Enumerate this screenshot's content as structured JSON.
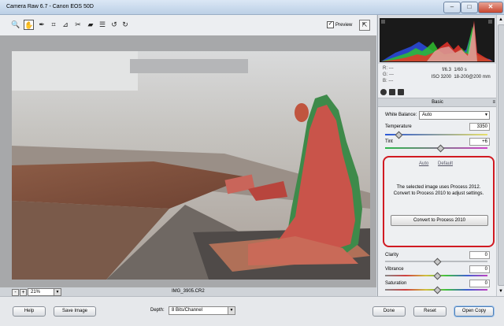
{
  "window": {
    "title": "Camera Raw 6.7  -  Canon EOS 50D",
    "minimize": "–",
    "maximize": "□",
    "close": "✕"
  },
  "toolbar": {
    "tools": [
      "🔍",
      "✋",
      "✒",
      "⌗",
      "⊿",
      "✂",
      "▰",
      "☰",
      "↺",
      "↻"
    ],
    "preview_label": "Preview",
    "preview_checked": "✓",
    "fullscreen": "⇱"
  },
  "image": {
    "filename": "IMG_3905.CR2",
    "zoom": "21%",
    "zoom_minus": "-",
    "zoom_plus": "+",
    "warning": "!"
  },
  "info": {
    "r_label": "R:",
    "r_value": "---",
    "g_label": "G:",
    "g_value": "---",
    "b_label": "B:",
    "b_value": "---",
    "aperture": "f/6.3",
    "shutter": "1/60 s",
    "iso": "ISO 3200",
    "lens": "18-200@200 mm"
  },
  "panel": {
    "section_title": "Basic",
    "section_menu": "≡",
    "white_balance_label": "White Balance:",
    "white_balance_value": "Auto",
    "temperature_label": "Temperature",
    "temperature_value": "3350",
    "tint_label": "Tint",
    "tint_value": "+6",
    "auto_link": "Auto",
    "default_link": "Default",
    "process_message": "The selected image uses Process 2012.  Convert to Process 2010 to adjust settings.",
    "convert_button": "Convert to Process 2010",
    "clarity_label": "Clarity",
    "clarity_value": "0",
    "vibrance_label": "Vibrance",
    "vibrance_value": "0",
    "saturation_label": "Saturation",
    "saturation_value": "0",
    "slider_levels": {
      "temperature": 0.12,
      "tint": 0.53,
      "clarity": 0.5,
      "vibrance": 0.5,
      "saturation": 0.5
    }
  },
  "bottom": {
    "help": "Help",
    "save_image": "Save Image",
    "depth_label": "Depth:",
    "depth_value": "8 Bits/Channel",
    "done": "Done",
    "reset": "Reset",
    "open_copy": "Open Copy"
  },
  "colors": {
    "highlight_box": "#d11a22",
    "accent": "#4f7fb6"
  }
}
